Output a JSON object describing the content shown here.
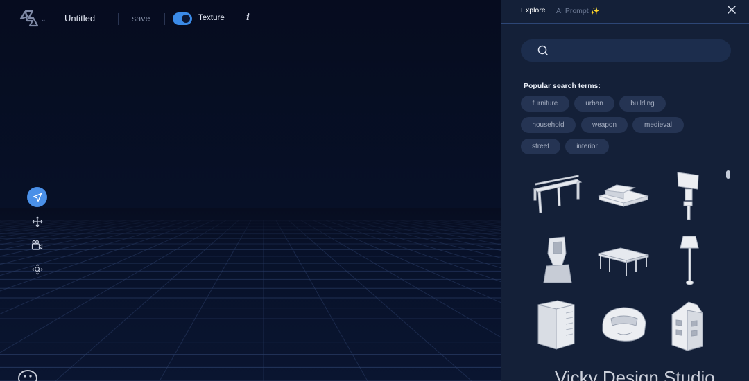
{
  "header": {
    "title": "Untitled",
    "save_label": "save",
    "texture_label": "Texture",
    "texture_enabled": true,
    "info_label": "i"
  },
  "tools": [
    {
      "name": "select",
      "icon": "navigation-arrow-icon",
      "active": true
    },
    {
      "name": "move",
      "icon": "move-arrows-icon",
      "active": false
    },
    {
      "name": "camera",
      "icon": "video-camera-icon",
      "active": false
    },
    {
      "name": "zoom",
      "icon": "zoom-move-icon",
      "active": false
    }
  ],
  "panel": {
    "tabs": [
      {
        "label": "Explore",
        "active": true
      },
      {
        "label": "AI Prompt ✨",
        "active": false
      }
    ],
    "search": {
      "placeholder": "",
      "value": ""
    },
    "popular_label": "Popular search terms:",
    "chips": [
      "furniture",
      "urban",
      "building",
      "household",
      "weapon",
      "medieval",
      "street",
      "interior"
    ],
    "models": [
      "bench",
      "low-building",
      "signpost",
      "tower",
      "pavilion",
      "floor-lamp",
      "server-cabinet",
      "helmet",
      "townhouse"
    ]
  },
  "watermark": "Vicky Design Studio",
  "colors": {
    "accent": "#4a90e8",
    "background": "#070d20",
    "panel": "#142038",
    "chip": "#253453"
  }
}
